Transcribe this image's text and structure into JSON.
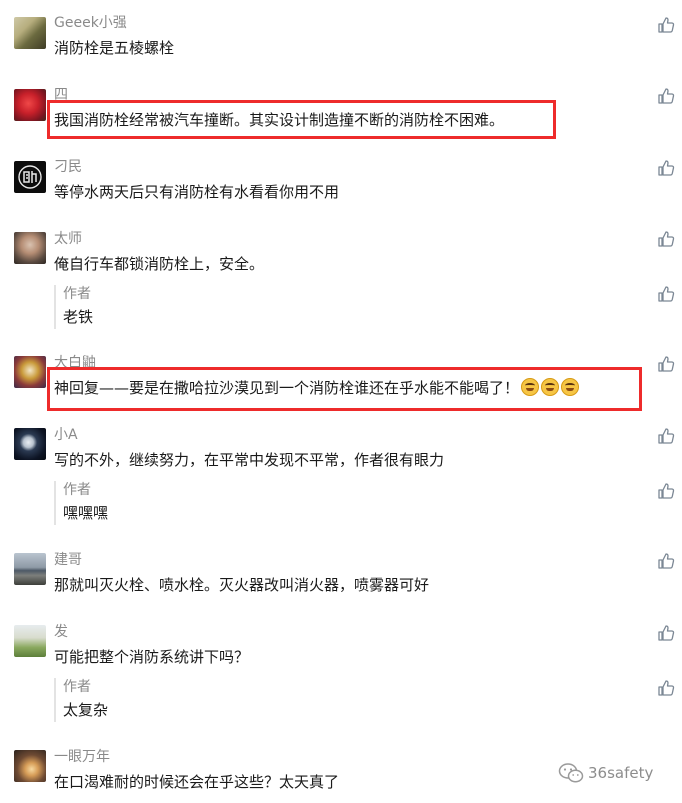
{
  "comments": [
    {
      "user": "Geeek小强",
      "text": "消防栓是五棱螺栓",
      "avatar": "leaf-avatar"
    },
    {
      "user": "四",
      "text": "我国消防栓经常被汽车撞断。其实设计制造撞不断的消防栓不困难。",
      "avatar": "red-flower-avatar"
    },
    {
      "user": "刁民",
      "text": "等停水两天后只有消防栓有水看看你用不用",
      "avatar": "calligraphy-avatar"
    },
    {
      "user": "太师",
      "text": "俺自行车都锁消防栓上，安全。",
      "avatar": "portrait-avatar",
      "reply": {
        "author": "作者",
        "text": "老铁"
      }
    },
    {
      "user": "大白鼬",
      "text": "神回复——要是在撒哈拉沙漠见到一个消防栓谁还在乎水能不能喝了！",
      "avatar": "cartoon-avatar",
      "emoji_count": 3
    },
    {
      "user": "小A",
      "text": "写的不外，继续努力，在平常中发现不平常，作者很有眼力",
      "avatar": "moon-avatar",
      "reply": {
        "author": "作者",
        "text": "嘿嘿嘿"
      }
    },
    {
      "user": "建哥",
      "text": "那就叫灭火栓、喷水栓。灭火器改叫消火器，喷雾器可好",
      "avatar": "lake-avatar"
    },
    {
      "user": "发",
      "text": "可能把整个消防系统讲下吗？",
      "avatar": "child-avatar",
      "reply": {
        "author": "作者",
        "text": "太复杂"
      }
    },
    {
      "user": "一眼万年",
      "text": "在口渴难耐的时候还会在乎这些？太天真了",
      "avatar": "sunset-avatar"
    }
  ],
  "watermark": {
    "text": "36safety",
    "icon": "wechat-icon"
  },
  "colors": {
    "highlight": "#ee2b2b",
    "username": "#8a8a8a",
    "text": "#1a1a1a",
    "like": "#7b8794"
  }
}
